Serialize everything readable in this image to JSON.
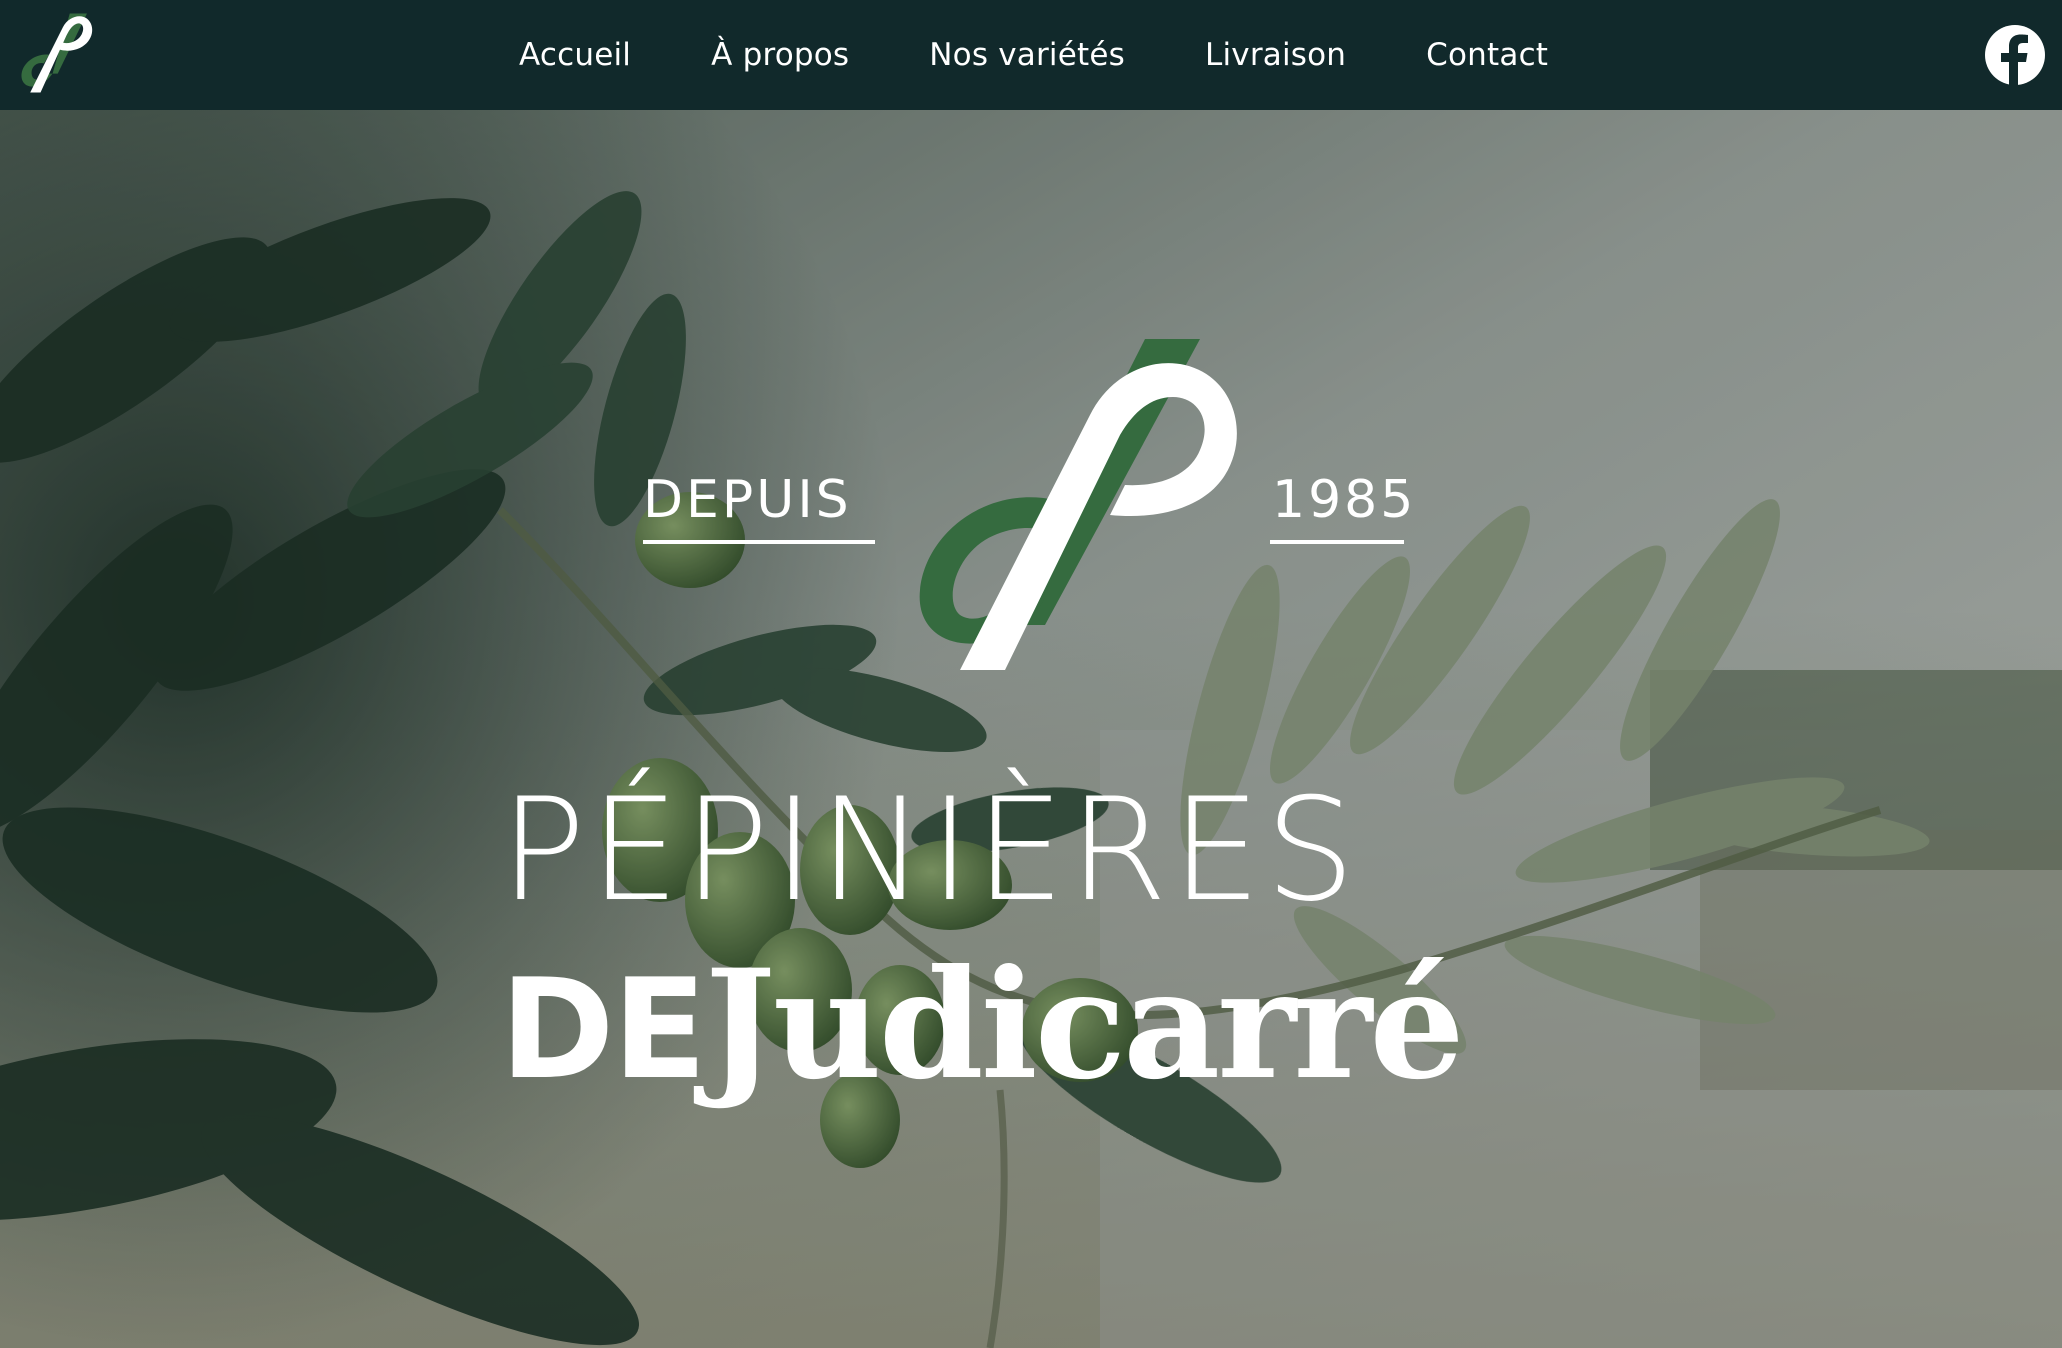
{
  "nav": {
    "items": [
      {
        "label": "Accueil"
      },
      {
        "label": "À propos"
      },
      {
        "label": "Nos variétés"
      },
      {
        "label": "Livraison"
      },
      {
        "label": "Contact"
      }
    ],
    "social": "facebook-icon"
  },
  "hero": {
    "left_tag": "DEPUIS",
    "right_tag": "1985",
    "title_line1": "PÉPINIÈRES",
    "title_line2_prefix": "DE",
    "title_line2_name": "Judicarré"
  },
  "colors": {
    "nav_bg": "#11292b",
    "brand_green": "#356b3f",
    "text": "#ffffff"
  }
}
